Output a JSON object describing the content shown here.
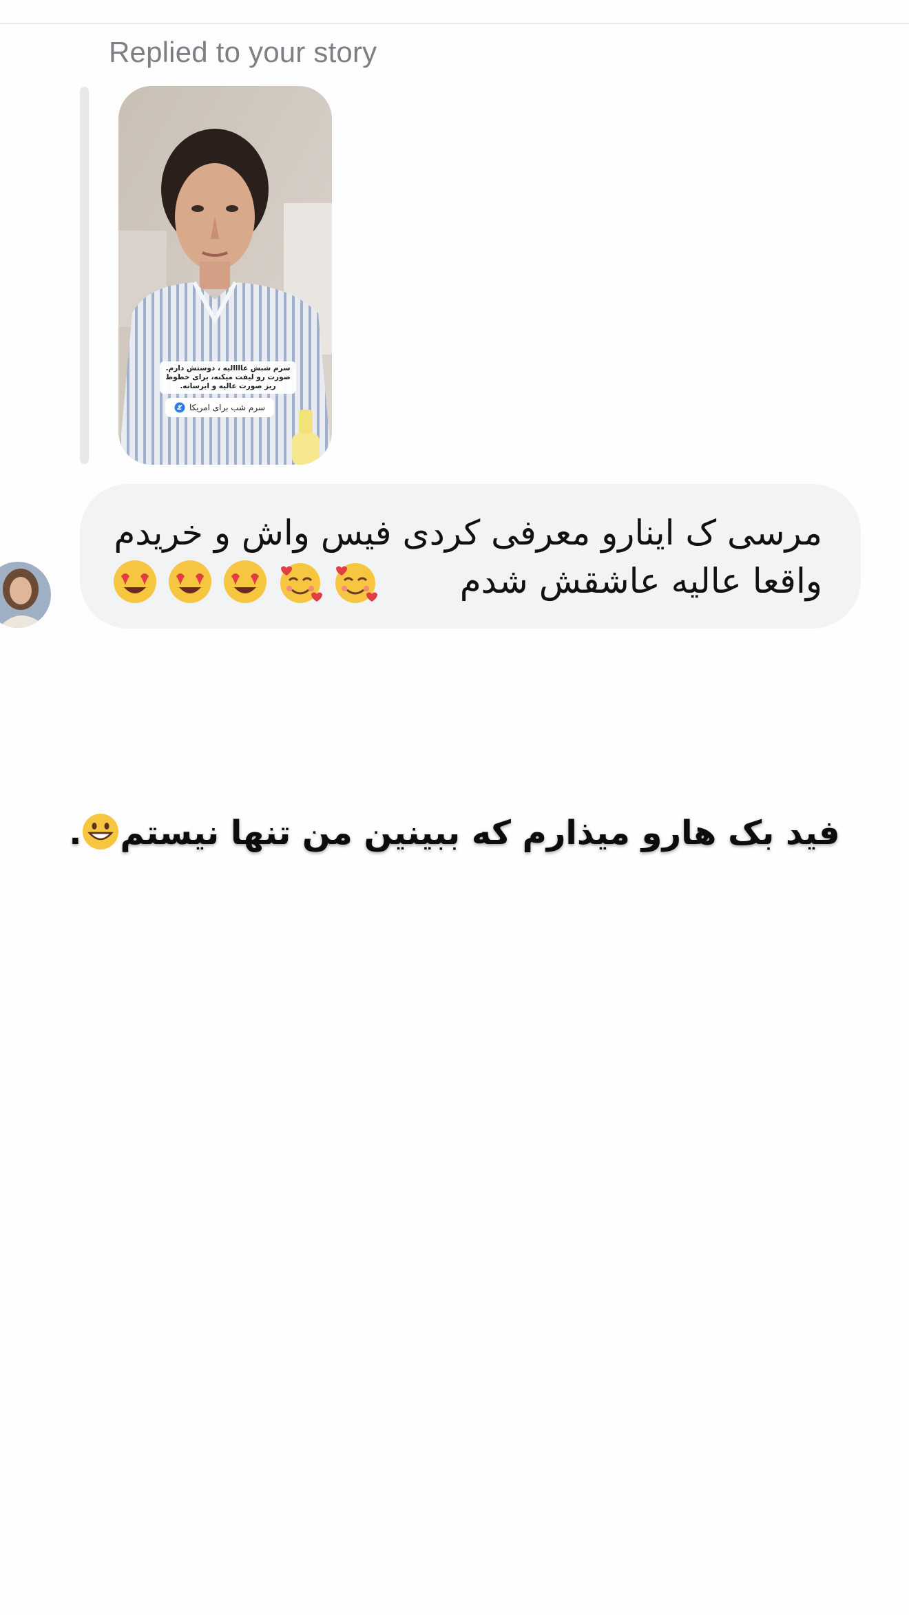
{
  "header": {
    "replied_label": "Replied to your story"
  },
  "story": {
    "caption": "سرم شبش عاااالیه ، دوستش دارم.\nصورت رو لیفت میکنه، برای خطوط ریز صورت عالیه و ابرسانه.",
    "link_sticker": "سرم شب برای امریکا",
    "icon": "link-icon"
  },
  "message": {
    "text": "مرسی ک اینارو معرفی کردی فیس واش و خریدم واقعا عالیه عاشقش شدم",
    "emojis": [
      "smiling-face-with-hearts",
      "smiling-face-with-hearts",
      "heart-eyes",
      "heart-eyes",
      "heart-eyes"
    ]
  },
  "overlay": {
    "caption": "فید بک هارو میذارم که ببینین من تنها نیستم",
    "trailing": ".",
    "emoji": "grinning-face"
  },
  "colors": {
    "bubble": "#f2f3f5",
    "label": "#7d7f85",
    "background": "#fefefe"
  }
}
